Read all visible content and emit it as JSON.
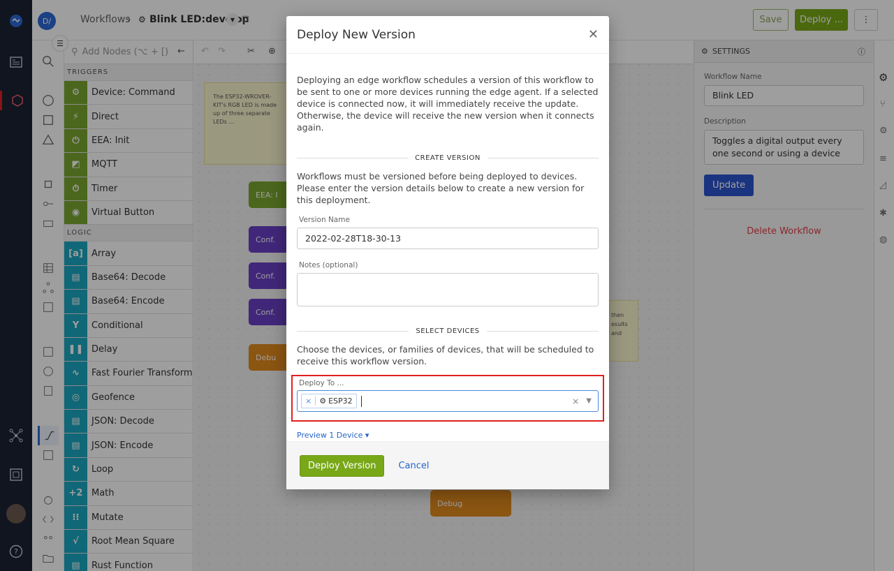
{
  "breadcrumb": {
    "root": "Workflows",
    "separator": "›",
    "current": "Blink LED:develop",
    "avatar": "D/"
  },
  "header_buttons": {
    "save": "Save",
    "deploy": "Deploy ...",
    "more": "⋮"
  },
  "palette": {
    "search_placeholder": "Add Nodes (⌥ + [)",
    "groups": [
      {
        "label": "TRIGGERS",
        "nodes": [
          {
            "label": "Device: Command",
            "color": "#7aa630",
            "icon": "⚙"
          },
          {
            "label": "Direct",
            "color": "#7aa630",
            "icon": "⚡"
          },
          {
            "label": "EEA: Init",
            "color": "#7aa630",
            "icon": "⏻"
          },
          {
            "label": "MQTT",
            "color": "#7aa630",
            "icon": "◩"
          },
          {
            "label": "Timer",
            "color": "#7aa630",
            "icon": "⏱"
          },
          {
            "label": "Virtual Button",
            "color": "#7aa630",
            "icon": "◉"
          }
        ]
      },
      {
        "label": "LOGIC",
        "nodes": [
          {
            "label": "Array",
            "color": "#1aa7c0",
            "icon": "[a]"
          },
          {
            "label": "Base64: Decode",
            "color": "#1aa7c0",
            "icon": "▤"
          },
          {
            "label": "Base64: Encode",
            "color": "#1aa7c0",
            "icon": "▤"
          },
          {
            "label": "Conditional",
            "color": "#1aa7c0",
            "icon": "Y"
          },
          {
            "label": "Delay",
            "color": "#1aa7c0",
            "icon": "❚❚"
          },
          {
            "label": "Fast Fourier Transform",
            "color": "#1aa7c0",
            "icon": "∿"
          },
          {
            "label": "Geofence",
            "color": "#1aa7c0",
            "icon": "◎"
          },
          {
            "label": "JSON: Decode",
            "color": "#1aa7c0",
            "icon": "▤"
          },
          {
            "label": "JSON: Encode",
            "color": "#1aa7c0",
            "icon": "▤"
          },
          {
            "label": "Loop",
            "color": "#1aa7c0",
            "icon": "↻"
          },
          {
            "label": "Math",
            "color": "#1aa7c0",
            "icon": "+2"
          },
          {
            "label": "Mutate",
            "color": "#1aa7c0",
            "icon": "⁝⁝"
          },
          {
            "label": "Root Mean Square",
            "color": "#1aa7c0",
            "icon": "√"
          },
          {
            "label": "Rust Function",
            "color": "#1aa7c0",
            "icon": "▤"
          }
        ]
      }
    ]
  },
  "canvas": {
    "note_text": "The ESP32-WROVER-KIT's RGB LED is made up of three separate LEDs ...",
    "nodes": [
      {
        "label": "EEA: I",
        "color": "#7aa630"
      },
      {
        "label": "Conf.",
        "color": "#6a3fc4"
      },
      {
        "label": "Conf.",
        "color": "#6a3fc4"
      },
      {
        "label": "Conf.",
        "color": "#6a3fc4"
      },
      {
        "label": "Debu",
        "color": "#e08a1e"
      },
      {
        "label": "Debug",
        "color": "#e08a1e"
      }
    ],
    "note2": [
      "then",
      "esults",
      "and"
    ]
  },
  "settings": {
    "title": "SETTINGS",
    "name_label": "Workflow Name",
    "name_value": "Blink LED",
    "desc_label": "Description",
    "desc_value": "Toggles a digital output every one second or using a device",
    "update": "Update",
    "delete": "Delete Workflow"
  },
  "modal": {
    "title": "Deploy New Version",
    "intro": "Deploying an edge workflow schedules a version of this workflow to be sent to one or more devices running the edge agent. If a selected device is connected now, it will immediately receive the update. Otherwise, the device will receive the new version when it connects again.",
    "create_heading": "CREATE VERSION",
    "create_text": "Workflows must be versioned before being deployed to devices. Please enter the version details below to create a new version for this deployment.",
    "version_label": "Version Name",
    "version_value": "2022-02-28T18-30-13",
    "notes_label": "Notes (optional)",
    "notes_value": "",
    "select_heading": "SELECT DEVICES",
    "select_text": "Choose the devices, or families of devices, that will be scheduled to receive this workflow version.",
    "deploy_to_label": "Deploy To ...",
    "chip": "ESP32",
    "preview": "Preview 1 Device",
    "deploy_button": "Deploy Version",
    "cancel": "Cancel"
  },
  "colors": {
    "accent_green": "#78a818",
    "link_blue": "#2463c9",
    "highlight_red": "#e0201f",
    "nav_dark": "#1b2333"
  }
}
